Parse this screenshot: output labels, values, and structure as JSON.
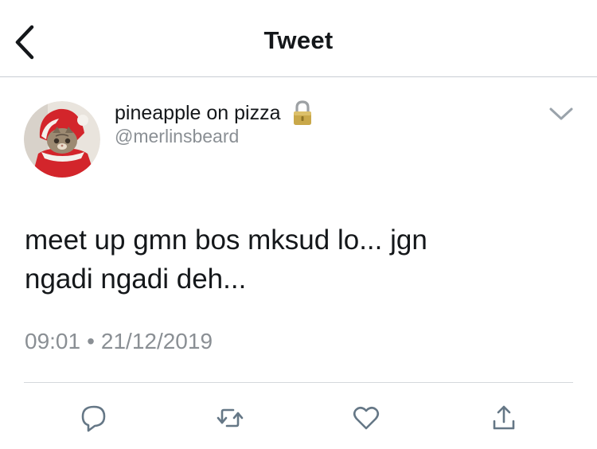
{
  "header": {
    "title": "Tweet",
    "back_icon": "chevron-left-icon"
  },
  "author": {
    "display_name": "pineapple on pizza",
    "handle": "@merlinsbeard",
    "protected_icon": "lock-icon",
    "avatar": "cat-in-santa-costume"
  },
  "tweet": {
    "text_line1": "meet up gmn bos mksud lo... jgn",
    "text_line2": "ngadi ngadi deh...",
    "time": "09:01",
    "separator": "•",
    "date": "21/12/2019"
  },
  "actions": [
    {
      "icon": "reply-icon"
    },
    {
      "icon": "retweet-icon"
    },
    {
      "icon": "like-icon"
    },
    {
      "icon": "share-icon"
    }
  ],
  "colors": {
    "text": "#14171a",
    "secondary": "#8a8f94",
    "accent": "#1da1f2",
    "divider": "#d4d8dc"
  }
}
